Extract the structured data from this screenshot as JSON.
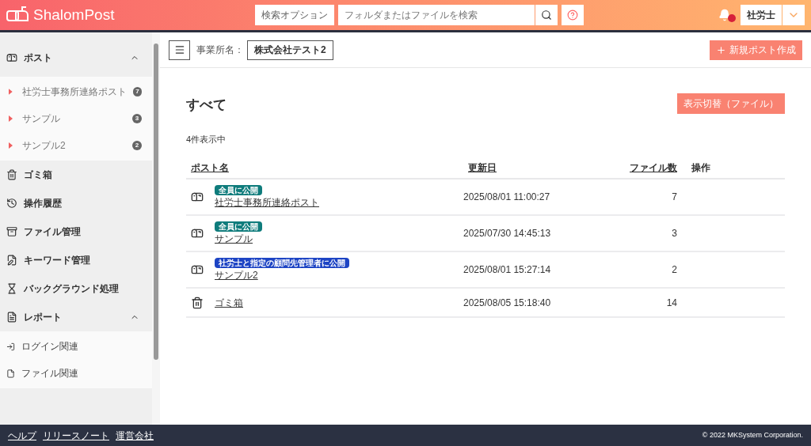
{
  "header": {
    "logo": "ShalomPost",
    "search_option": "検索オプション",
    "search": {
      "placeholder": "フォルダまたはファイルを検索"
    },
    "notification": true,
    "user": "社労士"
  },
  "sidebar": {
    "items": [
      {
        "kind": "group",
        "label": "ポスト",
        "expanded": true,
        "children": [
          {
            "kind": "post",
            "label": "社労士事務所連絡ポスト",
            "count": "7"
          },
          {
            "kind": "post",
            "label": "サンプル",
            "count": "3"
          },
          {
            "kind": "post",
            "label": "サンプル2",
            "count": "2"
          }
        ]
      },
      {
        "kind": "link",
        "label": "ゴミ箱"
      },
      {
        "kind": "link",
        "label": "操作履歴"
      },
      {
        "kind": "link",
        "label": "ファイル管理"
      },
      {
        "kind": "link",
        "label": "キーワード管理"
      },
      {
        "kind": "link",
        "label": "バックグラウンド処理"
      },
      {
        "kind": "group",
        "label": "レポート",
        "expanded": true,
        "children": [
          {
            "kind": "report",
            "label": "ログイン関連"
          },
          {
            "kind": "report",
            "label": "ファイル関連"
          }
        ]
      }
    ]
  },
  "toolbar": {
    "office_label": "事業所名：",
    "office": "株式会社テスト2",
    "new_button": "新規ポスト作成"
  },
  "content": {
    "title": "すべて",
    "toggle_button": "表示切替（ファイル）",
    "count_text": "4件表示中",
    "table": {
      "columns": [
        "ポスト名",
        "更新日",
        "ファイル数",
        "操作"
      ],
      "rows": [
        {
          "kind": "post",
          "badge": "全員に公開",
          "color": "#0f7c7c",
          "name": "社労士事務所連絡ポスト",
          "updated": "2025/08/01 11:00:27",
          "files": "7"
        },
        {
          "kind": "post",
          "badge": "全員に公開",
          "color": "#0f7c7c",
          "name": "サンプル",
          "updated": "2025/07/30 14:45:13",
          "files": "3"
        },
        {
          "kind": "post",
          "badge": "社労士と指定の顧問先管理者に公開",
          "color": "#1d44c4",
          "name": "サンプル2",
          "updated": "2025/08/01 15:27:14",
          "files": "2"
        },
        {
          "kind": "trash",
          "name": "ゴミ箱",
          "updated": "2025/08/05 15:18:40",
          "files": "14"
        }
      ]
    }
  },
  "footer": {
    "links": [
      "ヘルプ",
      "リリースノート",
      "運営会社"
    ],
    "copyright": "© 2022 MKSystem Corporation."
  }
}
